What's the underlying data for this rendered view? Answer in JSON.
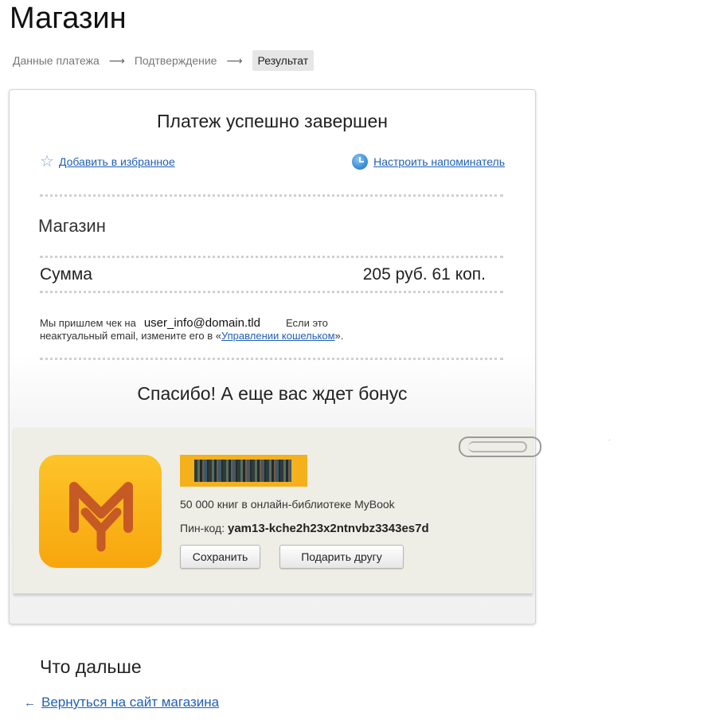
{
  "header": {
    "title": "Магазин"
  },
  "breadcrumb": {
    "steps": [
      "Данные платежа",
      "Подтверждение",
      "Результат"
    ],
    "active_index": 2
  },
  "card": {
    "title": "Платеж успешно завершен",
    "favorite_link": "Добавить в избранное",
    "reminder_link": "Настроить напоминатель",
    "shop_name": "Магазин",
    "amount_label": "Сумма",
    "amount_value": "205 руб. 61 коп.",
    "receipt": {
      "text_before_email": "Мы пришлем чек на",
      "email": "user_info@domain.tld",
      "text_after_email": "Если это",
      "line2_before_link": "неактуальный email, измените его в «",
      "link": "Управлении кошельком",
      "line2_after_link": "»."
    },
    "bonus_title": "Спасибо! А еще вас ждет бонус",
    "bonus": {
      "description": "50 000 книг в онлайн-библиотеке MyBook",
      "pin_label": "Пин-код:",
      "pin_code": "yam13-kche2h23x2ntnvbz3343es7d",
      "save_button": "Сохранить",
      "gift_button": "Подарить другу"
    }
  },
  "next": {
    "title": "Что дальше",
    "back_arrow": "←",
    "back_link": "Вернуться на сайт магазина"
  },
  "icons": {
    "favorite": "star-outline",
    "reminder": "clock",
    "clip": "paperclip",
    "logo": "mybook-logo",
    "back": "arrow-left"
  },
  "colors": {
    "link": "#2160b8",
    "logo_yellow": "#f7a60c",
    "logo_mark": "#c65a25",
    "bonus_panel": "#eeeee7",
    "active_crumb_bg": "#e6e6e6"
  }
}
